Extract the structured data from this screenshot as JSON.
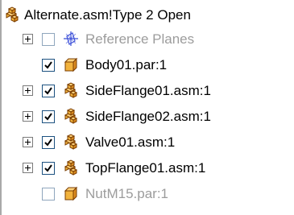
{
  "tree": {
    "root": {
      "label": "Alternate.asm!Type 2 Open",
      "icon": "assembly-icon"
    },
    "items": [
      {
        "label": "Reference Planes",
        "icon": "reference-planes-icon",
        "expandable": true,
        "checked": false,
        "dimmed": true
      },
      {
        "label": "Body01.par:1",
        "icon": "part-icon",
        "expandable": false,
        "checked": true,
        "dimmed": false
      },
      {
        "label": "SideFlange01.asm:1",
        "icon": "assembly-icon",
        "expandable": true,
        "checked": true,
        "dimmed": false
      },
      {
        "label": "SideFlange02.asm:1",
        "icon": "assembly-icon",
        "expandable": true,
        "checked": true,
        "dimmed": false
      },
      {
        "label": "Valve01.asm:1",
        "icon": "assembly-icon",
        "expandable": true,
        "checked": true,
        "dimmed": false
      },
      {
        "label": "TopFlange01.asm:1",
        "icon": "assembly-icon",
        "expandable": true,
        "checked": true,
        "dimmed": false
      },
      {
        "label": "NutM15.par:1",
        "icon": "part-icon",
        "expandable": false,
        "checked": false,
        "dimmed": true
      }
    ]
  },
  "colors": {
    "part_fill": "#f2b33d",
    "assembly_fill": "#e8a23a",
    "reference_plane_stroke": "#3b4fd8",
    "dimmed_text": "#9c9c9c"
  }
}
